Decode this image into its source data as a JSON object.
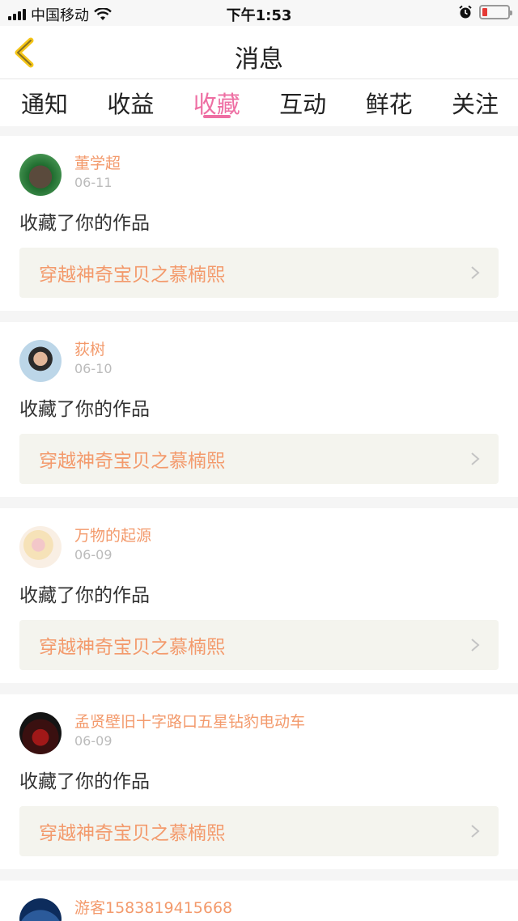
{
  "status_bar": {
    "carrier": "中国移动",
    "time": "下午1:53"
  },
  "nav": {
    "title": "消息"
  },
  "tabs": [
    {
      "label": "通知",
      "active": false
    },
    {
      "label": "收益",
      "active": false
    },
    {
      "label": "收藏",
      "active": true
    },
    {
      "label": "互动",
      "active": false
    },
    {
      "label": "鲜花",
      "active": false
    },
    {
      "label": "关注",
      "active": false
    }
  ],
  "colors": {
    "accent_pink": "#ee6fa3",
    "name_orange": "#f39a6c",
    "link_bg": "#f4f4ee"
  },
  "items": [
    {
      "name": "董学超",
      "date": "06-11",
      "action": "收藏了你的作品",
      "work": "穿越神奇宝贝之慕楠熙"
    },
    {
      "name": "荻树",
      "date": "06-10",
      "action": "收藏了你的作品",
      "work": "穿越神奇宝贝之慕楠熙"
    },
    {
      "name": "万物的起源",
      "date": "06-09",
      "action": "收藏了你的作品",
      "work": "穿越神奇宝贝之慕楠熙"
    },
    {
      "name": "孟贤壁旧十字路口五星钻豹电动车",
      "date": "06-09",
      "action": "收藏了你的作品",
      "work": "穿越神奇宝贝之慕楠熙"
    },
    {
      "name": "游客1583819415668",
      "date": "",
      "action": "",
      "work": ""
    }
  ]
}
